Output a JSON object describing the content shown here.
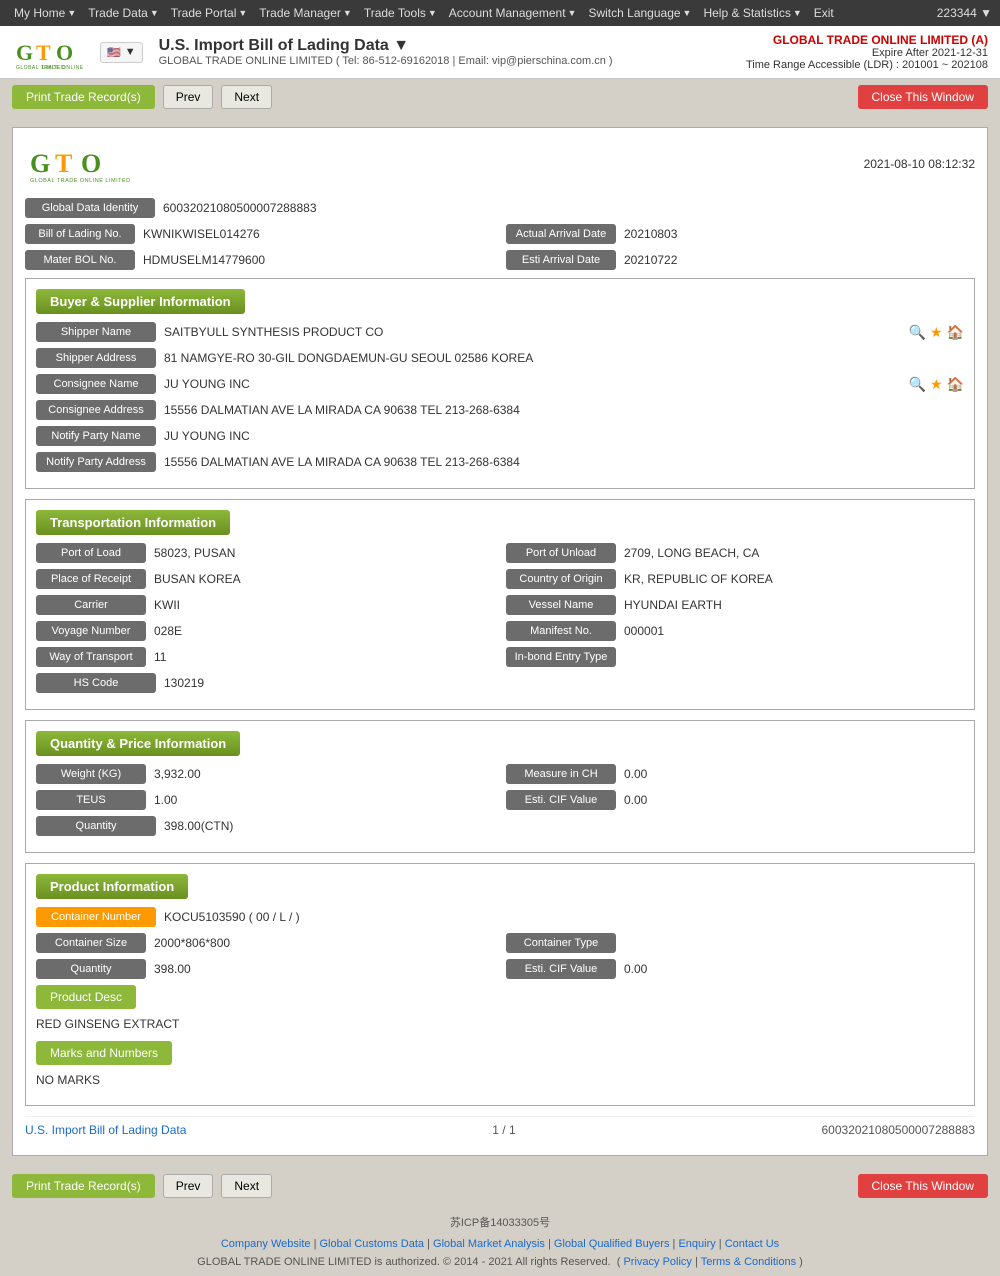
{
  "topNav": {
    "items": [
      {
        "label": "My Home",
        "hasArrow": true
      },
      {
        "label": "Trade Data",
        "hasArrow": true
      },
      {
        "label": "Trade Portal",
        "hasArrow": true
      },
      {
        "label": "Trade Manager",
        "hasArrow": true
      },
      {
        "label": "Trade Tools",
        "hasArrow": true
      },
      {
        "label": "Account Management",
        "hasArrow": true
      },
      {
        "label": "Switch Language",
        "hasArrow": true
      },
      {
        "label": "Help & Statistics",
        "hasArrow": true
      },
      {
        "label": "Exit",
        "hasArrow": false
      }
    ],
    "userId": "223344 ▼"
  },
  "header": {
    "title": "U.S. Import Bill of Lading Data ▼",
    "subtitle": "GLOBAL TRADE ONLINE LIMITED ( Tel: 86-512-69162018 | Email: vip@pierschina.com.cn )",
    "company": "GLOBAL TRADE ONLINE LIMITED (A)",
    "expire": "Expire After 2021-12-31",
    "timeRange": "Time Range Accessible (LDR) : 201001 ~ 202108",
    "flagCode": "🇺🇸"
  },
  "toolbar": {
    "printLabel": "Print Trade Record(s)",
    "prevLabel": "Prev",
    "nextLabel": "Next",
    "closeLabel": "Close This Window"
  },
  "record": {
    "datetime": "2021-08-10 08:12:32",
    "globalDataIdentity": "60032021080500007288883",
    "billOfLadingNo": "KWNIKWISEL014276",
    "actualArrivalDate": "20210803",
    "masterBolNo": "HDMUSELM14779600",
    "estiArrivalDate": "20210722",
    "sections": {
      "buyerSupplier": {
        "title": "Buyer & Supplier Information",
        "shipperName": "SAITBYULL SYNTHESIS PRODUCT CO",
        "shipperAddress": "81 NAMGYE-RO 30-GIL DONGDAEMUN-GU SEOUL 02586 KOREA",
        "consigneeName": "JU YOUNG INC",
        "consigneeAddress": "15556 DALMATIAN AVE LA MIRADA CA 90638 TEL 213-268-6384",
        "notifyPartyName": "JU YOUNG INC",
        "notifyPartyAddress": "15556 DALMATIAN AVE LA MIRADA CA 90638 TEL 213-268-6384"
      },
      "transportation": {
        "title": "Transportation Information",
        "portOfLoad": "58023, PUSAN",
        "portOfUnload": "2709, LONG BEACH, CA",
        "placeOfReceipt": "BUSAN KOREA",
        "countryOfOrigin": "KR, REPUBLIC OF KOREA",
        "carrier": "KWII",
        "vesselName": "HYUNDAI EARTH",
        "voyageNumber": "028E",
        "manifestNo": "000001",
        "wayOfTransport": "11",
        "inBondEntryType": "",
        "hsCode": "130219"
      },
      "quantityPrice": {
        "title": "Quantity & Price Information",
        "weightKg": "3,932.00",
        "measureInCH": "0.00",
        "teus": "1.00",
        "estiCifValue": "0.00",
        "quantity": "398.00(CTN)"
      },
      "product": {
        "title": "Product Information",
        "containerNumber": "KOCU5103590 ( 00 / L / )",
        "containerSize": "2000*806*800",
        "containerType": "",
        "quantity": "398.00",
        "estiCifValue": "0.00",
        "productDesc": "RED GINSENG EXTRACT",
        "marksAndNumbers": "NO MARKS"
      }
    },
    "pagination": {
      "link": "U.S. Import Bill of Lading Data",
      "pages": "1 / 1",
      "recordId": "60032021080500007288883"
    }
  },
  "footer": {
    "links": [
      "Company Website",
      "Global Customs Data",
      "Global Market Analysis",
      "Global Qualified Buyers",
      "Enquiry",
      "Contact Us"
    ],
    "copyright": "GLOBAL TRADE ONLINE LIMITED is authorized. © 2014 - 2021 All rights Reserved.",
    "privacyPolicy": "Privacy Policy",
    "termsAndConditions": "Terms & Conditions",
    "icp": "苏ICP备14033305号"
  },
  "labels": {
    "globalDataIdentity": "Global Data Identity",
    "billOfLadingNo": "Bill of Lading No.",
    "actualArrivalDate": "Actual Arrival Date",
    "masterBolNo": "Mater BOL No.",
    "estiArrivalDate": "Esti Arrival Date",
    "shipperName": "Shipper Name",
    "shipperAddress": "Shipper Address",
    "consigneeName": "Consignee Name",
    "consigneeAddress": "Consignee Address",
    "notifyPartyName": "Notify Party Name",
    "notifyPartyAddress": "Notify Party Address",
    "portOfLoad": "Port of Load",
    "portOfUnload": "Port of Unload",
    "placeOfReceipt": "Place of Receipt",
    "countryOfOrigin": "Country of Origin",
    "carrier": "Carrier",
    "vesselName": "Vessel Name",
    "voyageNumber": "Voyage Number",
    "manifestNo": "Manifest No.",
    "wayOfTransport": "Way of Transport",
    "inBondEntryType": "In-bond Entry Type",
    "hsCode": "HS Code",
    "weightKg": "Weight (KG)",
    "measureInCH": "Measure in CH",
    "teus": "TEUS",
    "estiCifValue": "Esti. CIF Value",
    "quantity": "Quantity",
    "containerNumber": "Container Number",
    "containerSize": "Container Size",
    "containerType": "Container Type",
    "productDesc": "Product Desc",
    "marksAndNumbers": "Marks and Numbers"
  }
}
